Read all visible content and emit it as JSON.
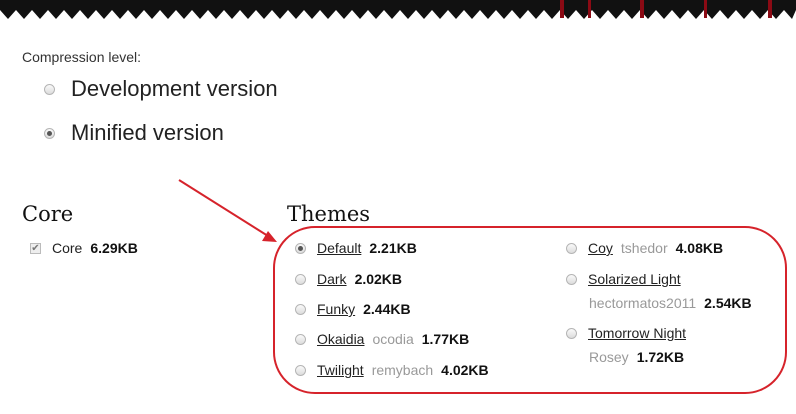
{
  "compression": {
    "label": "Compression level:",
    "options": [
      {
        "label": "Development version",
        "checked": false
      },
      {
        "label": "Minified version",
        "checked": true
      }
    ]
  },
  "core": {
    "title": "Core",
    "items": [
      {
        "name": "Core",
        "size": "6.29KB",
        "checked": true
      }
    ]
  },
  "themes": {
    "title": "Themes",
    "items": [
      {
        "name": "Default",
        "author": "",
        "size": "2.21KB",
        "checked": true
      },
      {
        "name": "Dark",
        "author": "",
        "size": "2.02KB",
        "checked": false
      },
      {
        "name": "Funky",
        "author": "",
        "size": "2.44KB",
        "checked": false
      },
      {
        "name": "Okaidia",
        "author": "ocodia",
        "size": "1.77KB",
        "checked": false
      },
      {
        "name": "Twilight",
        "author": "remybach",
        "size": "4.02KB",
        "checked": false
      },
      {
        "name": "Coy",
        "author": "tshedor",
        "size": "4.08KB",
        "checked": false
      },
      {
        "name": "Solarized Light",
        "author": "hectormatos2011",
        "size": "2.54KB",
        "checked": false
      },
      {
        "name": "Tomorrow Night",
        "author": "Rosey",
        "size": "1.72KB",
        "checked": false
      }
    ]
  },
  "colors": {
    "annotation": "#d6232b",
    "banner_dark": "#111111",
    "banner_red": "#8b0a14"
  }
}
